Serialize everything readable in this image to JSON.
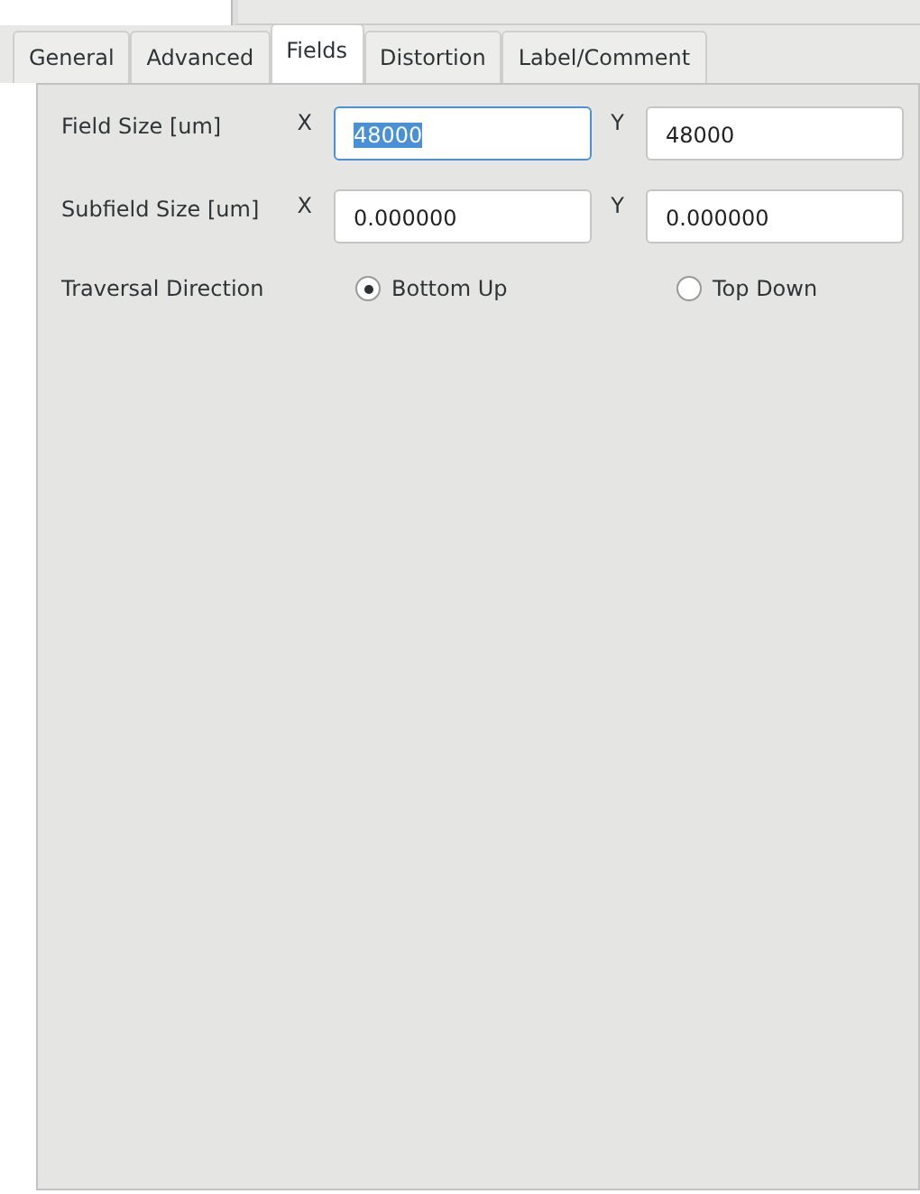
{
  "tabs": [
    {
      "label": "General",
      "selected": false
    },
    {
      "label": "Advanced",
      "selected": false
    },
    {
      "label": "Fields",
      "selected": true
    },
    {
      "label": "Distortion",
      "selected": false
    },
    {
      "label": "Label/Comment",
      "selected": false
    }
  ],
  "rows": [
    {
      "label": "Field Size [um]",
      "fields": [
        {
          "axis": "X",
          "value": "48000",
          "focused": true
        },
        {
          "axis": "Y",
          "value": "48000",
          "focused": false
        }
      ]
    },
    {
      "label": "Subfield Size [um]",
      "fields": [
        {
          "axis": "X",
          "value": "0.000000",
          "focused": false
        },
        {
          "axis": "Y",
          "value": "0.000000",
          "focused": false
        }
      ]
    }
  ],
  "traversal": {
    "label": "Traversal Direction",
    "options": [
      {
        "label": "Bottom Up",
        "selected": true
      },
      {
        "label": "Top Down",
        "selected": false
      }
    ]
  }
}
